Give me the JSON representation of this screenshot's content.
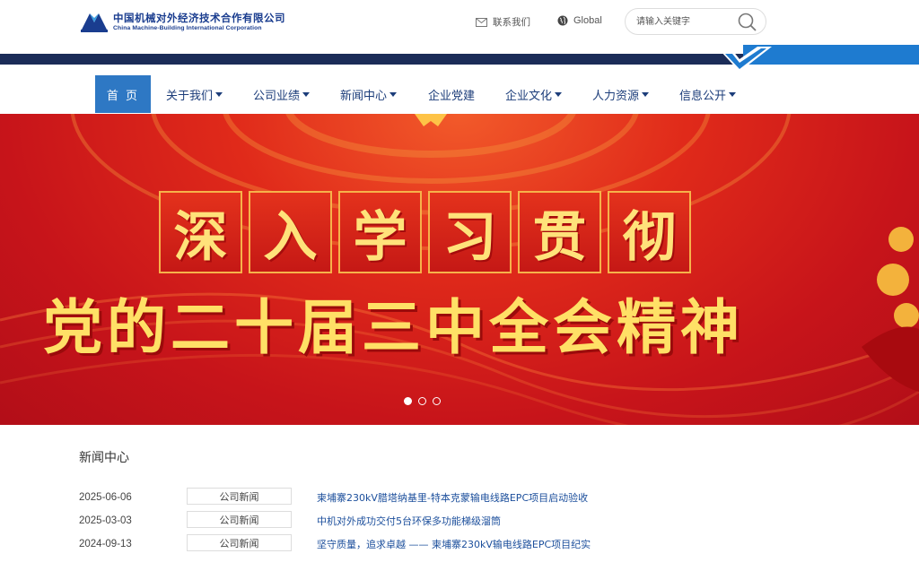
{
  "header": {
    "logo_cn": "中国机械对外经济技术合作有限公司",
    "logo_en": "China Machine-Building International Corporation",
    "contact_label": "联系我们",
    "global_label": "Global",
    "search_placeholder": "请输入关键字"
  },
  "nav": {
    "items": [
      {
        "label": "首 页",
        "active": true
      },
      {
        "label": "关于我们",
        "dropdown": true
      },
      {
        "label": "公司业绩",
        "dropdown": true
      },
      {
        "label": "新闻中心",
        "dropdown": true
      },
      {
        "label": "企业党建",
        "dropdown": false
      },
      {
        "label": "企业文化",
        "dropdown": true
      },
      {
        "label": "人力资源",
        "dropdown": true
      },
      {
        "label": "信息公开",
        "dropdown": true
      }
    ]
  },
  "banner": {
    "tiles": [
      "深",
      "入",
      "学",
      "习",
      "贯",
      "彻"
    ],
    "headline": "党的二十届三中全会精神",
    "slide_count": 3,
    "active_slide": 1
  },
  "news": {
    "title": "新闻中心",
    "rows": [
      {
        "date": "2025-06-06",
        "category": "公司新闻",
        "headline": "柬埔寨230kV腊塔纳基里-特本克蒙输电线路EPC项目启动验收"
      },
      {
        "date": "2025-03-03",
        "category": "公司新闻",
        "headline": "中机对外成功交付5台环保多功能梯级溜筒"
      },
      {
        "date": "2024-09-13",
        "category": "公司新闻",
        "headline": "坚守质量，追求卓越 —— 柬埔寨230kV输电线路EPC项目纪实"
      }
    ]
  },
  "colors": {
    "brand_dark": "#1b2c58",
    "brand_blue": "#1e7bd0",
    "nav_active": "#2e78c4",
    "banner_red": "#d81e1a",
    "headline_gold": "#ffe066"
  }
}
